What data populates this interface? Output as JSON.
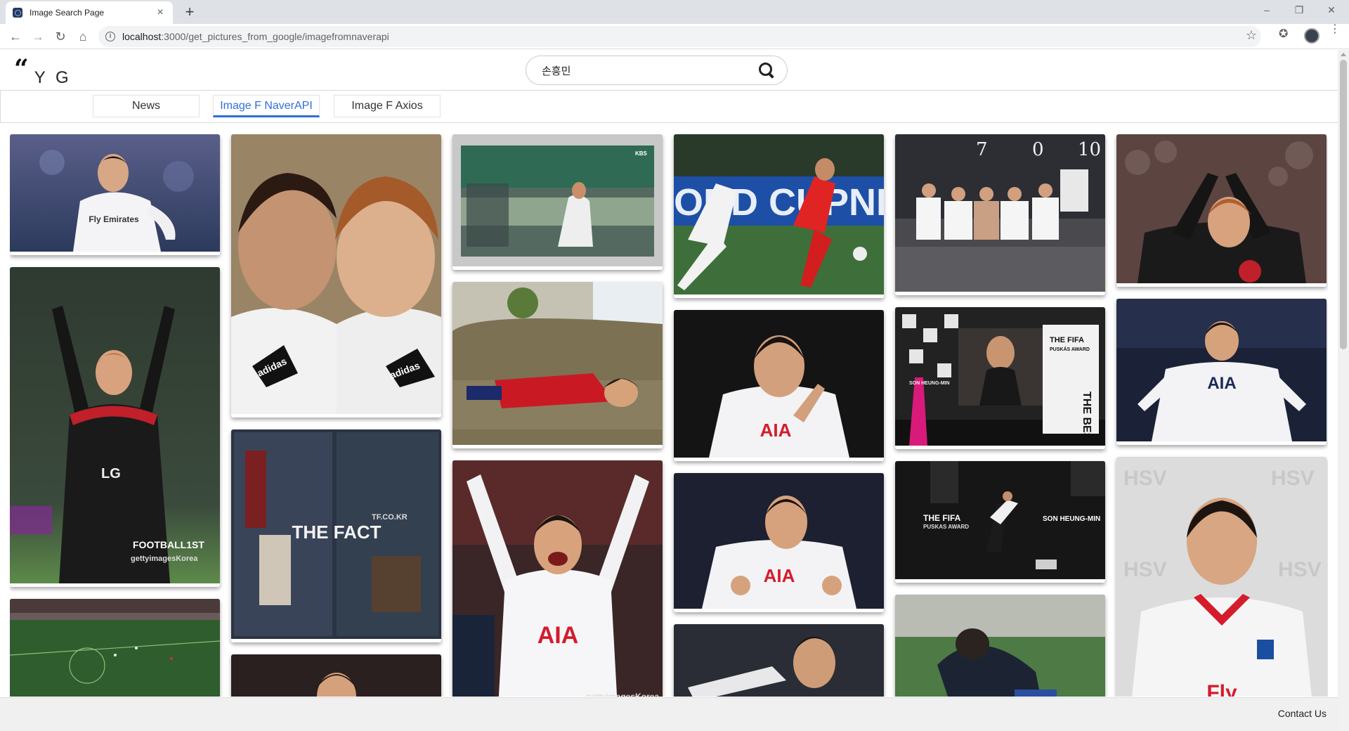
{
  "browser": {
    "tab_title": "Image Search Page",
    "tab_close": "×",
    "new_tab": "+",
    "url_host": "localhost",
    "url_path": ":3000/get_pictures_from_google/imagefromnaverapi",
    "window_controls": [
      "–",
      "❐",
      "✕"
    ],
    "icons": [
      "back-icon",
      "forward-icon",
      "reload-icon",
      "home-icon",
      "star-icon",
      "extensions-icon",
      "profile-avatar",
      "menu-dots-icon"
    ]
  },
  "header": {
    "logo_quote": "“",
    "logo_text": "Y G",
    "search_value": "손흥민"
  },
  "nav": {
    "tabs": [
      "News",
      "Image F NaverAPI",
      "Image F Axios"
    ],
    "active": "Image F NaverAPI"
  },
  "gallery": {
    "captions": {
      "emirates": "Fly Emirates",
      "adidas1": "adidas",
      "adidas2": "adidas",
      "korea": "KBS",
      "football": "FOOTBALL1ST",
      "getty1": "gettyimagesKorea",
      "thefact": "THE FACT",
      "tfco": "TF.CO.KR",
      "aia1": "AIA",
      "getty2": "gettyimagesKorea",
      "aia2": "AIA",
      "aia3": "AIA",
      "fifa1_top": "THE FIFA",
      "fifa1_sub": "PUSKÁS AWARD",
      "fifa1_name": "SON\nHEUNG-MIN",
      "fifa2_top": "THE FIFA",
      "fifa2_sub": "PUSKAS AWARD",
      "fifa2_name": "SON\nHEUNG-MIN",
      "best": "THE BEST",
      "hsv": "HSV",
      "fly": "Fly",
      "lg": "LG"
    }
  },
  "footer": {
    "contact": "Contact Us"
  },
  "colors": {
    "accent": "#2f6fd6",
    "tab_strip": "#dee1e6",
    "footer": "#f0f0f0"
  }
}
